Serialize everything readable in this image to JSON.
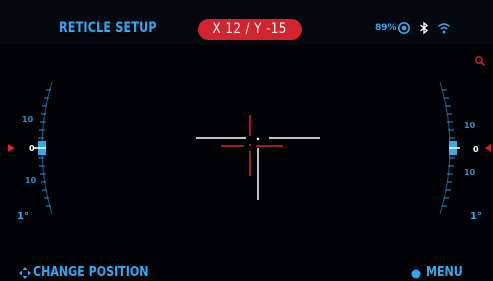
{
  "header": {
    "title": "RETICLE SETUP",
    "coordinates": "X 12 / Y -15",
    "battery": "89%",
    "icons": [
      "recording-icon",
      "bluetooth-icon",
      "wifi-icon"
    ]
  },
  "indicator": {
    "icon": "search-icon"
  },
  "left_scale": {
    "top": "10",
    "center": "0",
    "bottom": "10",
    "angle": "1°"
  },
  "right_scale": {
    "top": "10",
    "center": "0",
    "bottom": "10",
    "angle": "1°"
  },
  "footer": {
    "left_label": "CHANGE POSITION",
    "right_label": "MENU"
  },
  "colors": {
    "accent": "#33aaf0",
    "alert": "#d3232f",
    "background": "#010306"
  }
}
